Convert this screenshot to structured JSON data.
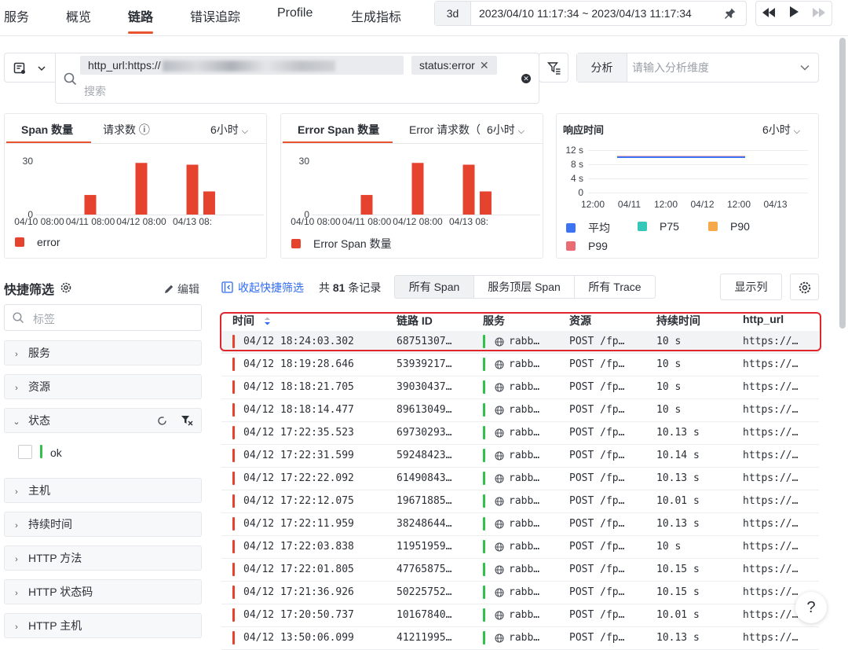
{
  "nav": {
    "tabs": [
      "服务",
      "概览",
      "链路",
      "错误追踪",
      "Profile",
      "生成指标"
    ],
    "active_index": 2
  },
  "time": {
    "range_btn": "3d",
    "range_text": "2023/04/10 11:17:34 ~ 2023/04/13 11:17:34"
  },
  "filter": {
    "chip1_label": "http_url:https://",
    "chip2_label": "status:error",
    "chip_close": "✕",
    "search_placeholder": "搜索",
    "analysis_label": "分析",
    "analysis_placeholder": "请输入分析维度"
  },
  "cards": {
    "span": {
      "tab_active": "Span 数量",
      "tab2": "请求数 ⓘ",
      "range": "6小时",
      "legend": "error"
    },
    "error": {
      "tab_active": "Error Span 数量",
      "tab2": "Error 请求数（",
      "range": "6小时",
      "legend": "Error Span 数量"
    },
    "resp": {
      "title": "响应时间",
      "range": "6小时",
      "legend": [
        {
          "label": "平均",
          "color": "#3b73f3"
        },
        {
          "label": "P75",
          "color": "#35c8b9"
        },
        {
          "label": "P90",
          "color": "#f5a94a"
        },
        {
          "label": "P99",
          "color": "#ea6b72"
        }
      ]
    }
  },
  "chart_data": [
    {
      "type": "bar",
      "title": "Span 数量",
      "x_ticks": [
        "04/10 08:00",
        "04/11 08:00",
        "04/12 08:00",
        "04/13 08:"
      ],
      "ylim": [
        0,
        30
      ],
      "y_ticks": [
        0,
        30
      ],
      "series": [
        {
          "name": "error",
          "color": "#e5432d",
          "points": [
            {
              "x": 1.0,
              "y": 11
            },
            {
              "x": 2.0,
              "y": 29
            },
            {
              "x": 3.0,
              "y": 28
            },
            {
              "x": 3.33,
              "y": 13
            }
          ]
        }
      ]
    },
    {
      "type": "bar",
      "title": "Error Span 数量",
      "x_ticks": [
        "04/10 08:00",
        "04/11 08:00",
        "04/12 08:00",
        "04/13 08:"
      ],
      "ylim": [
        0,
        30
      ],
      "y_ticks": [
        0,
        30
      ],
      "series": [
        {
          "name": "Error Span 数量",
          "color": "#e5432d",
          "points": [
            {
              "x": 1.0,
              "y": 11
            },
            {
              "x": 2.0,
              "y": 29
            },
            {
              "x": 3.0,
              "y": 28
            },
            {
              "x": 3.33,
              "y": 13
            }
          ]
        }
      ]
    },
    {
      "type": "line",
      "title": "响应时间",
      "x_ticks": [
        "12:00",
        "04/11",
        "12:00",
        "04/12",
        "12:00",
        "04/13"
      ],
      "y_ticks": [
        "12 s",
        "8 s",
        "4 s",
        "0"
      ],
      "ylim": [
        0,
        12
      ],
      "series": [
        {
          "name": "P99",
          "color": "#ea6b72",
          "values": [
            10.1,
            10.1
          ]
        },
        {
          "name": "平均",
          "color": "#3b73f3",
          "values": [
            10.0,
            10.0
          ]
        }
      ]
    }
  ],
  "side": {
    "title": "快捷筛选",
    "edit_label": "编辑",
    "search_placeholder": "标签",
    "items": [
      "服务",
      "资源",
      "状态",
      "主机",
      "持续时间",
      "HTTP 方法",
      "HTTP 状态码",
      "HTTP 主机"
    ],
    "status_option": "ok"
  },
  "toolbar": {
    "collapse_label": "收起快捷筛选",
    "count_prefix": "共",
    "count": "81",
    "count_suffix": "条记录",
    "seg": [
      "所有 Span",
      "服务顶层 Span",
      "所有 Trace"
    ],
    "columns_btn": "显示列"
  },
  "table": {
    "headers": [
      "时间",
      "链路 ID",
      "服务",
      "资源",
      "持续时间",
      "http_url"
    ],
    "rows": [
      {
        "time": "04/12 18:24:03.302",
        "id": "68751307…",
        "service": "rabb…",
        "resource": "POST /fp…",
        "duration": "10 s",
        "url": "https://…"
      },
      {
        "time": "04/12 18:19:28.646",
        "id": "53939217…",
        "service": "rabb…",
        "resource": "POST /fp…",
        "duration": "10 s",
        "url": "https://…"
      },
      {
        "time": "04/12 18:18:21.705",
        "id": "39030437…",
        "service": "rabb…",
        "resource": "POST /fp…",
        "duration": "10 s",
        "url": "https://…"
      },
      {
        "time": "04/12 18:18:14.477",
        "id": "89613049…",
        "service": "rabb…",
        "resource": "POST /fp…",
        "duration": "10 s",
        "url": "https://…"
      },
      {
        "time": "04/12 17:22:35.523",
        "id": "69730293…",
        "service": "rabb…",
        "resource": "POST /fp…",
        "duration": "10.13 s",
        "url": "https://…"
      },
      {
        "time": "04/12 17:22:31.599",
        "id": "59248423…",
        "service": "rabb…",
        "resource": "POST /fp…",
        "duration": "10.14 s",
        "url": "https://…"
      },
      {
        "time": "04/12 17:22:22.092",
        "id": "61490843…",
        "service": "rabb…",
        "resource": "POST /fp…",
        "duration": "10.13 s",
        "url": "https://…"
      },
      {
        "time": "04/12 17:22:12.075",
        "id": "19671885…",
        "service": "rabb…",
        "resource": "POST /fp…",
        "duration": "10.01 s",
        "url": "https://…"
      },
      {
        "time": "04/12 17:22:11.959",
        "id": "38248644…",
        "service": "rabb…",
        "resource": "POST /fp…",
        "duration": "10.13 s",
        "url": "https://…"
      },
      {
        "time": "04/12 17:22:03.838",
        "id": "11951959…",
        "service": "rabb…",
        "resource": "POST /fp…",
        "duration": "10 s",
        "url": "https://…"
      },
      {
        "time": "04/12 17:22:01.805",
        "id": "47765875…",
        "service": "rabb…",
        "resource": "POST /fp…",
        "duration": "10.15 s",
        "url": "https://…"
      },
      {
        "time": "04/12 17:21:36.926",
        "id": "50225752…",
        "service": "rabb…",
        "resource": "POST /fp…",
        "duration": "10.15 s",
        "url": "https://…"
      },
      {
        "time": "04/12 17:20:50.737",
        "id": "10167840…",
        "service": "rabb…",
        "resource": "POST /fp…",
        "duration": "10.01 s",
        "url": "https://…"
      },
      {
        "time": "04/12 13:50:06.099",
        "id": "41211995…",
        "service": "rabb…",
        "resource": "POST /fp…",
        "duration": "10.13 s",
        "url": "https://…"
      }
    ]
  },
  "help_label": "?"
}
